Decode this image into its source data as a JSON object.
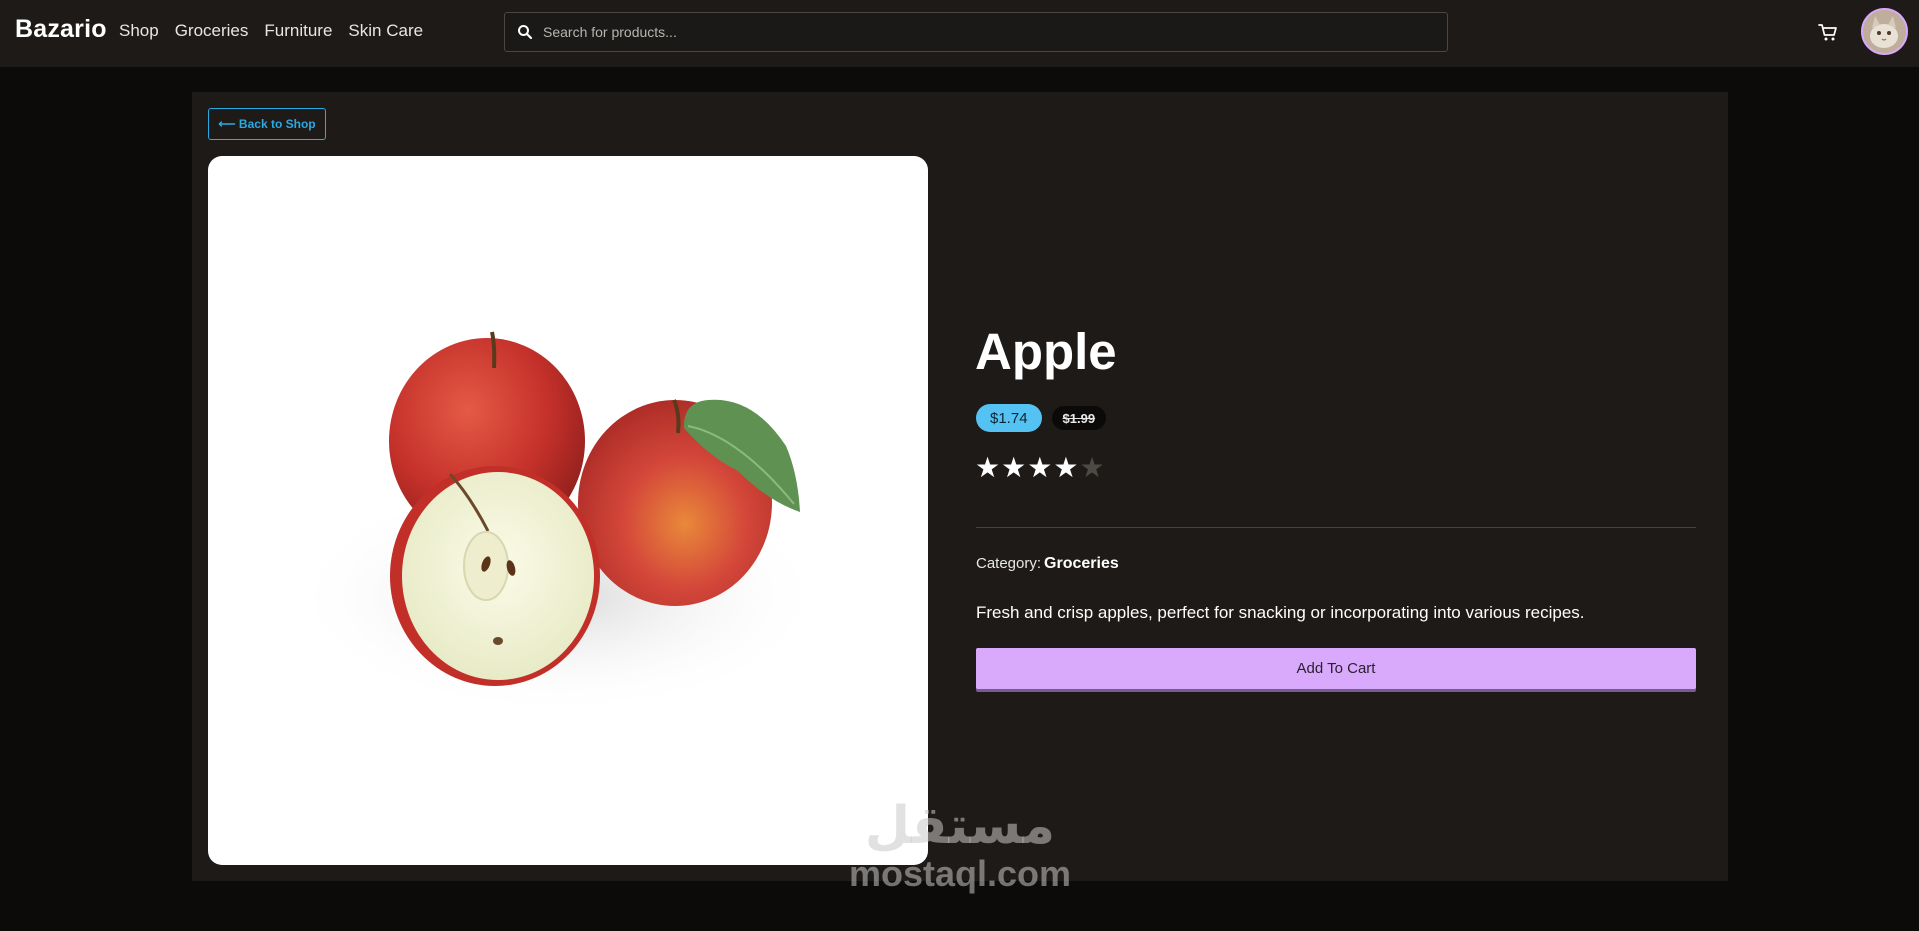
{
  "nav": {
    "brand": "Bazario",
    "links": [
      "Shop",
      "Groceries",
      "Furniture",
      "Skin Care"
    ],
    "search_placeholder": "Search for products...",
    "icons": {
      "search": "search-icon",
      "cart": "cart-icon",
      "avatar": "avatar"
    }
  },
  "product": {
    "back_label": "⟵ Back to Shop",
    "title": "Apple",
    "price": "$1.74",
    "old_price": "$1.99",
    "rating": 4,
    "rating_max": 5,
    "category_label": "Category:",
    "category_value": "Groceries",
    "description": "Fresh and crisp apples, perfect for snacking or incorporating into various recipes.",
    "add_to_cart_label": "Add To Cart"
  },
  "watermark": {
    "arabic": "مستقل",
    "latin": "mostaql.com"
  },
  "colors": {
    "navbar_bg": "#1d1a17",
    "page_bg": "#0c0b09",
    "panel_bg": "#1d1a17",
    "accent_blue": "#54c3f4",
    "accent_purple": "#d9aafb",
    "link_blue": "#2aa9e5"
  }
}
